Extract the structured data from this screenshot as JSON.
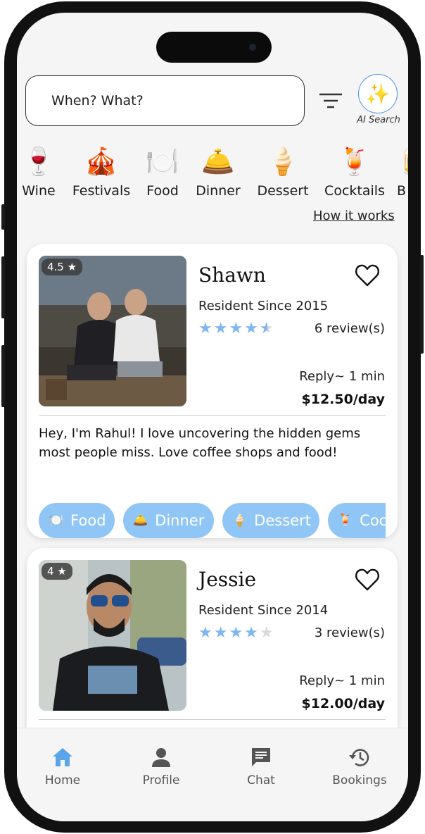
{
  "search": {
    "placeholder": "When? What?"
  },
  "ai_search": {
    "label": "AI Search",
    "icon": "sparkles-icon"
  },
  "categories": [
    {
      "label": "Wine",
      "emoji": "🍷"
    },
    {
      "label": "Festivals",
      "emoji": "🎪"
    },
    {
      "label": "Food",
      "emoji": "🍽️"
    },
    {
      "label": "Dinner",
      "emoji": "🛎️"
    },
    {
      "label": "Dessert",
      "emoji": "🍦"
    },
    {
      "label": "Cocktails",
      "emoji": "🍹"
    },
    {
      "label": "B",
      "emoji": "🍺"
    }
  ],
  "how_it_works": "How it works",
  "cards": [
    {
      "rating": "4.5 ★",
      "name": "Shawn",
      "since": "Resident Since 2015",
      "stars": 4.5,
      "reviews": "6 review(s)",
      "reply": "Reply~ 1 min",
      "price": "$12.50/day",
      "bio": "Hey, I'm Rahul! I love uncovering the hidden gems most people miss. Love coffee shops and food!",
      "tags": [
        {
          "label": "Food",
          "emoji": "🍽️"
        },
        {
          "label": "Dinner",
          "emoji": "🛎️"
        },
        {
          "label": "Dessert",
          "emoji": "🍦"
        },
        {
          "label": "Coc",
          "emoji": "🍹"
        }
      ]
    },
    {
      "rating": "4 ★",
      "name": "Jessie",
      "since": "Resident Since 2014",
      "stars": 4,
      "reviews": "3 review(s)",
      "reply": "Reply~ 1 min",
      "price": "$12.00/day"
    }
  ],
  "nav": [
    {
      "label": "Home",
      "icon": "home-icon",
      "active": true
    },
    {
      "label": "Profile",
      "icon": "person-icon"
    },
    {
      "label": "Chat",
      "icon": "chat-icon"
    },
    {
      "label": "Bookings",
      "icon": "history-icon"
    }
  ],
  "colors": {
    "accent": "#4a90e2",
    "tag": "#90c6f5",
    "star": "#7fb7ee",
    "nav_active": "#5aa4ea"
  }
}
